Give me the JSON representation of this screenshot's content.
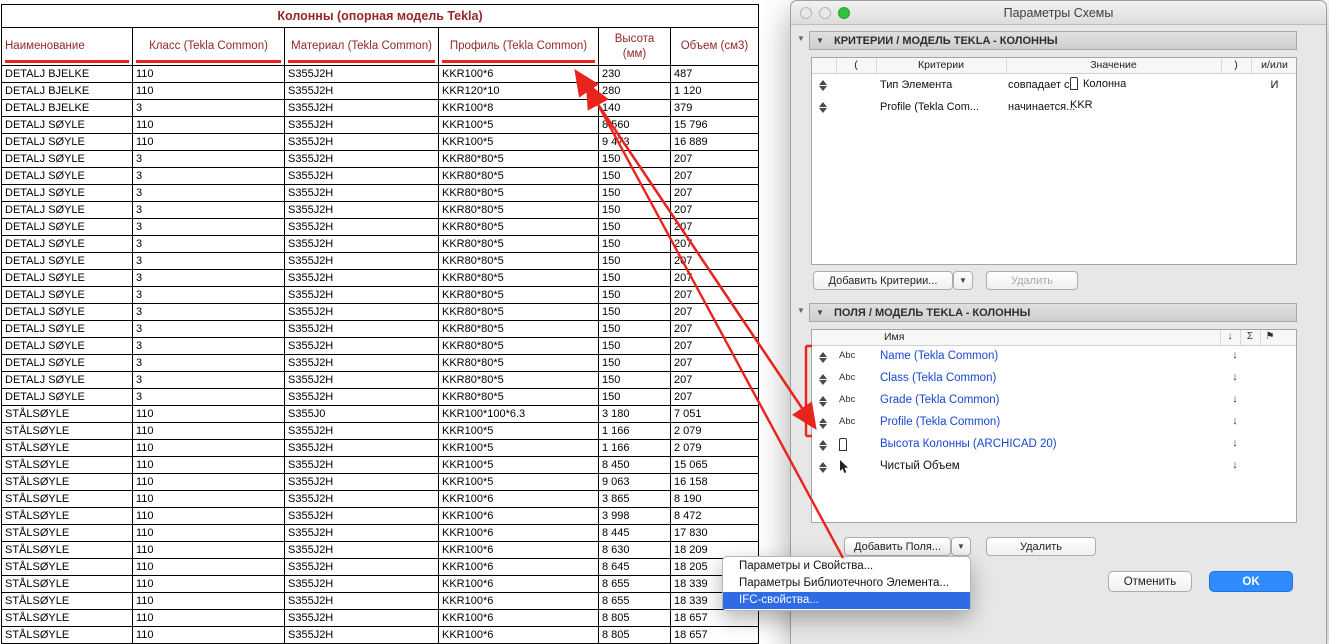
{
  "colors": {
    "red": "#e8251d",
    "maroon": "#942828",
    "blue": "#1747d1",
    "ok-blue": "#2f8bff",
    "menu-blue": "#2e6be5"
  },
  "icons": {
    "disclosure": "▼",
    "chevron": "▼",
    "sort": "↓",
    "sum": "Σ",
    "flag": "⚑"
  },
  "table": {
    "title": "Колонны (опорная модель Tekla)",
    "headers": [
      "Наименование",
      "Класс (Tekla Common)",
      "Материал (Tekla Common)",
      "Профиль (Tekla Common)",
      "Высота (мм)",
      "Объем (см3)"
    ],
    "underlined_headers": [
      0,
      1,
      2,
      3
    ],
    "rows": [
      [
        "DETALJ BJELKE",
        "110",
        "S355J2H",
        "KKR100*6",
        "230",
        "487"
      ],
      [
        "DETALJ BJELKE",
        "110",
        "S355J2H",
        "KKR120*10",
        "280",
        "1 120"
      ],
      [
        "DETALJ BJELKE",
        "3",
        "S355J2H",
        "KKR100*8",
        "140",
        "379"
      ],
      [
        "DETALJ SØYLE",
        "110",
        "S355J2H",
        "KKR100*5",
        "8 560",
        "15 796"
      ],
      [
        "DETALJ SØYLE",
        "110",
        "S355J2H",
        "KKR100*5",
        "9 473",
        "16 889"
      ],
      [
        "DETALJ SØYLE",
        "3",
        "S355J2H",
        "KKR80*80*5",
        "150",
        "207"
      ],
      [
        "DETALJ SØYLE",
        "3",
        "S355J2H",
        "KKR80*80*5",
        "150",
        "207"
      ],
      [
        "DETALJ SØYLE",
        "3",
        "S355J2H",
        "KKR80*80*5",
        "150",
        "207"
      ],
      [
        "DETALJ SØYLE",
        "3",
        "S355J2H",
        "KKR80*80*5",
        "150",
        "207"
      ],
      [
        "DETALJ SØYLE",
        "3",
        "S355J2H",
        "KKR80*80*5",
        "150",
        "207"
      ],
      [
        "DETALJ SØYLE",
        "3",
        "S355J2H",
        "KKR80*80*5",
        "150",
        "207"
      ],
      [
        "DETALJ SØYLE",
        "3",
        "S355J2H",
        "KKR80*80*5",
        "150",
        "207"
      ],
      [
        "DETALJ SØYLE",
        "3",
        "S355J2H",
        "KKR80*80*5",
        "150",
        "207"
      ],
      [
        "DETALJ SØYLE",
        "3",
        "S355J2H",
        "KKR80*80*5",
        "150",
        "207"
      ],
      [
        "DETALJ SØYLE",
        "3",
        "S355J2H",
        "KKR80*80*5",
        "150",
        "207"
      ],
      [
        "DETALJ SØYLE",
        "3",
        "S355J2H",
        "KKR80*80*5",
        "150",
        "207"
      ],
      [
        "DETALJ SØYLE",
        "3",
        "S355J2H",
        "KKR80*80*5",
        "150",
        "207"
      ],
      [
        "DETALJ SØYLE",
        "3",
        "S355J2H",
        "KKR80*80*5",
        "150",
        "207"
      ],
      [
        "DETALJ SØYLE",
        "3",
        "S355J2H",
        "KKR80*80*5",
        "150",
        "207"
      ],
      [
        "DETALJ SØYLE",
        "3",
        "S355J2H",
        "KKR80*80*5",
        "150",
        "207"
      ],
      [
        "STÅLSØYLE",
        "110",
        "S355J0",
        "KKR100*100*6.3",
        "3 180",
        "7 051"
      ],
      [
        "STÅLSØYLE",
        "110",
        "S355J2H",
        "KKR100*5",
        "1 166",
        "2 079"
      ],
      [
        "STÅLSØYLE",
        "110",
        "S355J2H",
        "KKR100*5",
        "1 166",
        "2 079"
      ],
      [
        "STÅLSØYLE",
        "110",
        "S355J2H",
        "KKR100*5",
        "8 450",
        "15 065"
      ],
      [
        "STÅLSØYLE",
        "110",
        "S355J2H",
        "KKR100*5",
        "9 063",
        "16 158"
      ],
      [
        "STÅLSØYLE",
        "110",
        "S355J2H",
        "KKR100*6",
        "3 865",
        "8 190"
      ],
      [
        "STÅLSØYLE",
        "110",
        "S355J2H",
        "KKR100*6",
        "3 998",
        "8 472"
      ],
      [
        "STÅLSØYLE",
        "110",
        "S355J2H",
        "KKR100*6",
        "8 445",
        "17 830"
      ],
      [
        "STÅLSØYLE",
        "110",
        "S355J2H",
        "KKR100*6",
        "8 630",
        "18 209"
      ],
      [
        "STÅLSØYLE",
        "110",
        "S355J2H",
        "KKR100*6",
        "8 645",
        "18 205"
      ],
      [
        "STÅLSØYLE",
        "110",
        "S355J2H",
        "KKR100*6",
        "8 655",
        "18 339"
      ],
      [
        "STÅLSØYLE",
        "110",
        "S355J2H",
        "KKR100*6",
        "8 655",
        "18 339"
      ],
      [
        "STÅLSØYLE",
        "110",
        "S355J2H",
        "KKR100*6",
        "8 805",
        "18 657"
      ],
      [
        "STÅLSØYLE",
        "110",
        "S355J2H",
        "KKR100*6",
        "8 805",
        "18 657"
      ]
    ]
  },
  "dialog": {
    "title": "Параметры Схемы",
    "criteria_section": {
      "header": "КРИТЕРИИ /  МОДЕЛЬ TEKLA - КОЛОННЫ",
      "columns": [
        "(",
        "Критерии",
        "Значение",
        ")",
        "и/или"
      ],
      "rows": [
        {
          "criteria": "Тип Элемента",
          "relation": "совпадает с",
          "value": "Колонна",
          "value_icon": "column",
          "andor": "И"
        },
        {
          "criteria": "Profile (Tekla Com...",
          "relation": "начинается...",
          "value": "KKR",
          "value_icon": "",
          "andor": ""
        }
      ],
      "add_button": "Добавить Критерии...",
      "delete_button": "Удалить"
    },
    "fields_section": {
      "header": "ПОЛЯ /  МОДЕЛЬ TEKLA - КОЛОННЫ",
      "name_column": "Имя",
      "rows": [
        {
          "type": "abc",
          "name": "Name (Tekla Common)",
          "color": "blue"
        },
        {
          "type": "abc",
          "name": "Class (Tekla Common)",
          "color": "blue"
        },
        {
          "type": "abc",
          "name": "Grade (Tekla Common)",
          "color": "blue"
        },
        {
          "type": "abc",
          "name": "Profile (Tekla Common)",
          "color": "blue"
        },
        {
          "type": "column",
          "name": "Высота Колонны (ARCHICAD 20)",
          "color": "blue"
        },
        {
          "type": "cursor",
          "name": "Чистый Объем",
          "color": "black"
        }
      ],
      "add_button": "Добавить Поля...",
      "delete_button": "Удалить"
    },
    "menu": {
      "items": [
        "Параметры и Свойства...",
        "Параметры Библиотечного Элемента...",
        "IFC-свойства..."
      ],
      "selected_index": 2
    },
    "cancel_button": "Отменить",
    "ok_button": "OK"
  }
}
